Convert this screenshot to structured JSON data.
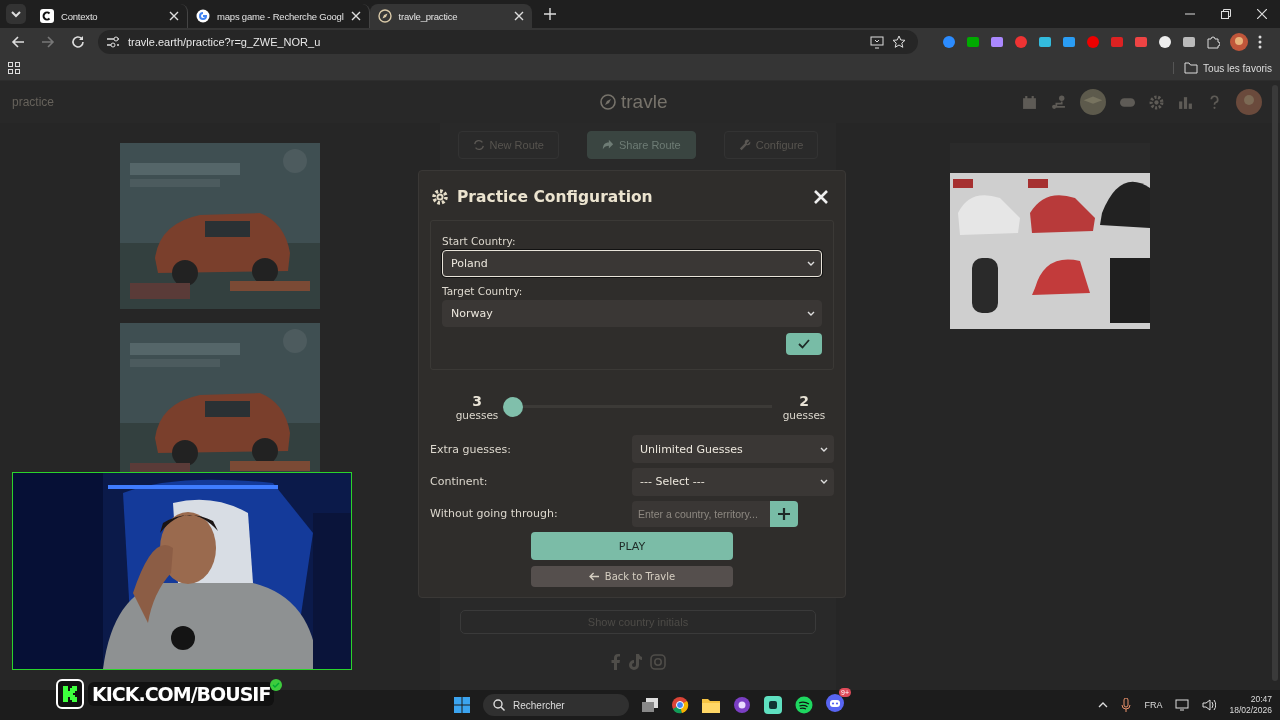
{
  "browser": {
    "tabs": [
      {
        "title": "Contexto",
        "selected": false
      },
      {
        "title": "maps game - Recherche Googl",
        "selected": false
      },
      {
        "title": "travle_practice",
        "selected": true
      }
    ],
    "url": "travle.earth/practice?r=g_ZWE_NOR_u",
    "bookmarks_folder": "Tous les favoris"
  },
  "page": {
    "header": {
      "page_name": "practice",
      "logo": "travle"
    },
    "toolbar": [
      {
        "label": "New Route",
        "selected": false
      },
      {
        "label": "Share Route",
        "selected": true
      },
      {
        "label": "Configure",
        "selected": false
      }
    ],
    "footer_button": "Show country initials"
  },
  "modal": {
    "title": "Practice Configuration",
    "fields": [
      {
        "label": "Start Country:",
        "value": "Poland",
        "focused": true
      },
      {
        "label": "Target Country:",
        "value": "Norway",
        "focused": false
      }
    ],
    "slider": {
      "left_value": "3",
      "left_unit": "guesses",
      "right_value": "2",
      "right_unit": "guesses",
      "level": 0
    },
    "options": [
      {
        "kind": "select",
        "label": "Extra guesses:",
        "value": "Unlimited Guesses"
      },
      {
        "kind": "select",
        "label": "Continent:",
        "value": "--- Select ---"
      },
      {
        "kind": "input",
        "label": "Without going through:",
        "placeholder": "Enter a country, territory..."
      }
    ],
    "play": "PLAY",
    "back": "Back to Travle"
  },
  "stream_overlay": {
    "channel": "KICK.COM/BOUSIF"
  },
  "taskbar": {
    "search_placeholder": "Rechercher",
    "discord_badge": "9+",
    "language": "FRA",
    "time": "20:47",
    "date": "18/02/2026"
  }
}
